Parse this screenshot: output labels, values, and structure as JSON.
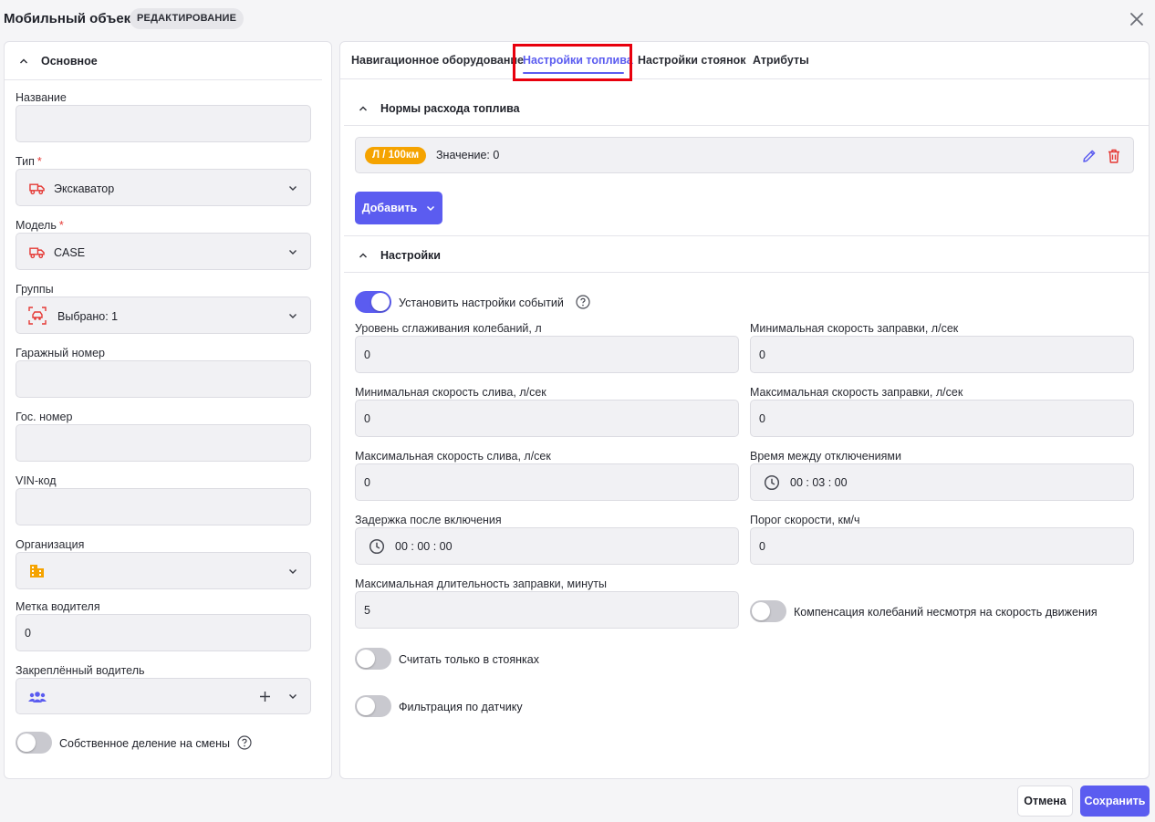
{
  "header": {
    "title": "Мобильный объект",
    "mode_badge": "РЕДАКТИРОВАНИЕ"
  },
  "left": {
    "section_title": "Основное",
    "fields": {
      "name": {
        "label": "Название",
        "value": ""
      },
      "type": {
        "label": "Тип",
        "required_mark": "*",
        "value": "Экскаватор",
        "icon": "vehicle-icon"
      },
      "model": {
        "label": "Модель",
        "required_mark": "*",
        "value": "CASE",
        "icon": "vehicle-icon"
      },
      "groups": {
        "label": "Группы",
        "value": "Выбрано: 1",
        "icon": "group-vehicle-icon"
      },
      "garage_number": {
        "label": "Гаражный номер",
        "value": ""
      },
      "state_number": {
        "label": "Гос. номер",
        "value": ""
      },
      "vin": {
        "label": "VIN-код",
        "value": ""
      },
      "organization": {
        "label": "Организация",
        "value": "",
        "icon": "building-icon"
      },
      "driver_tag": {
        "label": "Метка водителя",
        "value": "0"
      },
      "assigned_driver": {
        "label": "Закреплённый водитель",
        "value": "",
        "icon": "people-icon"
      }
    },
    "own_shift_toggle": {
      "label": "Собственное деление на смены",
      "on": false
    }
  },
  "tabs": [
    {
      "label": "Навигационное оборудование",
      "active": false
    },
    {
      "label": "Настройки топлива",
      "active": true
    },
    {
      "label": "Настройки стоянок",
      "active": false
    },
    {
      "label": "Атрибуты",
      "active": false
    }
  ],
  "fuel_norms": {
    "section_title": "Нормы расхода топлива",
    "items": [
      {
        "unit": "Л / 100км",
        "value_text": "Значение: 0"
      }
    ],
    "add_button": "Добавить"
  },
  "settings": {
    "section_title": "Настройки",
    "event_settings_toggle": {
      "label": "Установить настройки событий",
      "on": true
    },
    "fields": {
      "smoothing_level": {
        "label": "Уровень сглаживания колебаний, л",
        "value": "0"
      },
      "min_refuel_speed": {
        "label": "Минимальная скорость заправки, л/сек",
        "value": "0"
      },
      "min_drain_speed": {
        "label": "Минимальная скорость слива, л/сек",
        "value": "0"
      },
      "max_refuel_speed": {
        "label": "Максимальная скорость заправки, л/сек",
        "value": "0"
      },
      "max_drain_speed": {
        "label": "Максимальная скорость слива, л/сек",
        "value": "0"
      },
      "time_between_shutdowns": {
        "label": "Время между отключениями",
        "value": "00 : 03 : 00"
      },
      "delay_after_on": {
        "label": "Задержка после включения",
        "value": "00 : 00 : 00"
      },
      "speed_threshold": {
        "label": "Порог скорости, км/ч",
        "value": "0"
      },
      "max_refuel_duration": {
        "label": "Максимальная длительность заправки, минуты",
        "value": "5"
      }
    },
    "compensation_toggle": {
      "label": "Компенсация колебаний несмотря на скорость движения",
      "on": false
    },
    "only_parking_toggle": {
      "label": "Считать только в стоянках",
      "on": false
    },
    "sensor_filter_toggle": {
      "label": "Фильтрация по датчику",
      "on": false
    }
  },
  "footer": {
    "cancel": "Отмена",
    "save": "Сохранить"
  },
  "colors": {
    "accent": "#5b5cf0",
    "unit_badge": "#f5a300",
    "danger": "#e53935",
    "highlight": "#e8000d"
  }
}
